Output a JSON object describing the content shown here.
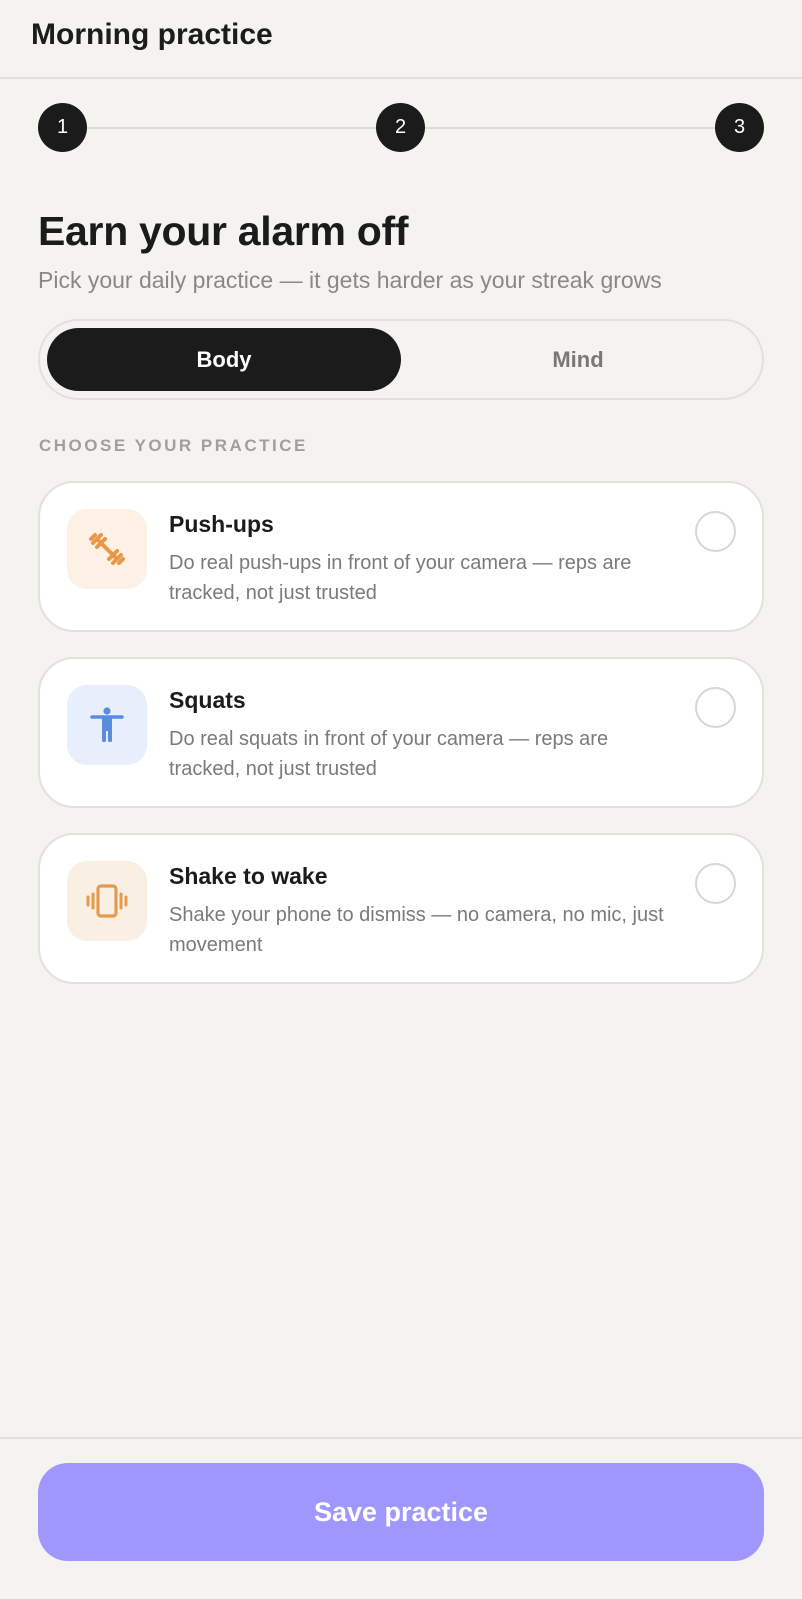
{
  "header": {
    "title": "Morning practice"
  },
  "stepper": {
    "steps": [
      "1",
      "2",
      "3"
    ]
  },
  "intro": {
    "heading": "Earn your alarm off",
    "subheading": "Pick your daily practice — it gets harder as your streak grows"
  },
  "segments": {
    "active": "Body",
    "items": [
      "Body",
      "Mind"
    ]
  },
  "section_label": "CHOOSE YOUR PRACTICE",
  "practices": [
    {
      "title": "Push-ups",
      "description": "Do real push-ups in front of your camera — reps are tracked, not just trusted",
      "icon": "dumbbell-icon",
      "icon_color": "#e9974a",
      "selected": false
    },
    {
      "title": "Squats",
      "description": "Do real squats in front of your camera — reps are tracked, not just trusted",
      "icon": "person-icon",
      "icon_color": "#5b8be0",
      "selected": false
    },
    {
      "title": "Shake to wake",
      "description": "Shake your phone to dismiss — no camera, no mic, just movement",
      "icon": "phone-vibrate-icon",
      "icon_color": "#e39a4e",
      "selected": false
    }
  ],
  "footer": {
    "save_label": "Save practice"
  },
  "colors": {
    "primary_button": "#9f97fd",
    "dark": "#1b1b1b",
    "background": "#f4f3f0"
  }
}
